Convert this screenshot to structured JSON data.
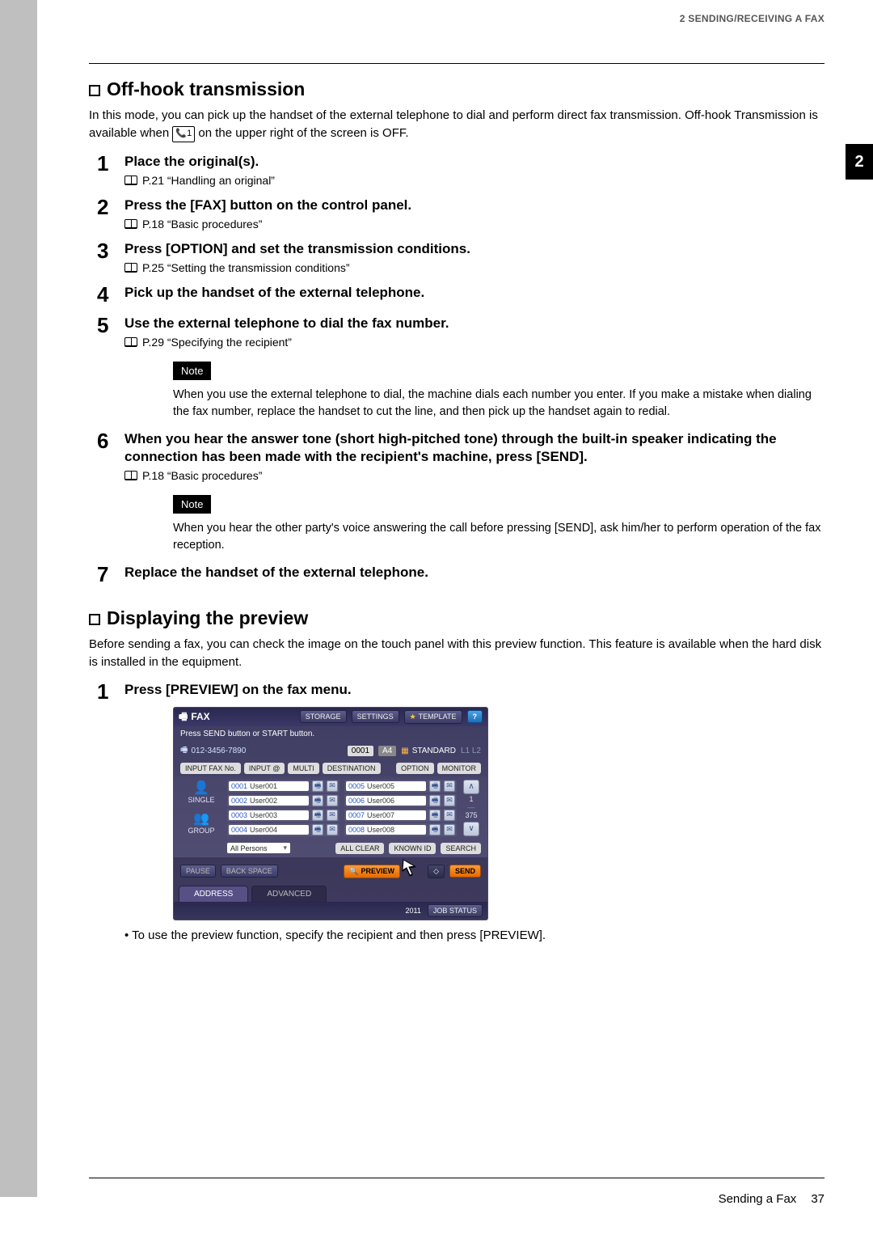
{
  "header": {
    "breadcrumb": "2 SENDING/RECEIVING A FAX"
  },
  "side_tab": "2",
  "section1": {
    "title": "Off-hook transmission",
    "intro_a": "In this mode, you can pick up the handset of the external telephone to dial and perform direct fax transmission. Off-hook Transmission is available when ",
    "intro_icon": "📞1",
    "intro_b": " on the upper right of the screen is OFF."
  },
  "steps": [
    {
      "n": "1",
      "title": "Place the original(s).",
      "ref": "P.21 “Handling an original”"
    },
    {
      "n": "2",
      "title": "Press the [FAX] button on the control panel.",
      "ref": "P.18 “Basic procedures”"
    },
    {
      "n": "3",
      "title": "Press [OPTION] and set the transmission conditions.",
      "ref": "P.25 “Setting the transmission conditions”"
    },
    {
      "n": "4",
      "title": "Pick up the handset of the external telephone."
    },
    {
      "n": "5",
      "title": "Use the external telephone to dial the fax number.",
      "ref": "P.29 “Specifying the recipient”",
      "note": "When you use the external telephone to dial, the machine dials each number you enter. If you make a mistake when dialing the fax number, replace the handset to cut the line, and then pick up the handset again to redial."
    },
    {
      "n": "6",
      "title": "When you hear the answer tone (short high-pitched tone) through the built-in speaker indicating the connection has been made with the recipient's machine, press [SEND].",
      "ref": "P.18 “Basic procedures”",
      "note": "When you hear the other party's voice answering the call before pressing [SEND], ask him/her to perform operation of the fax reception."
    },
    {
      "n": "7",
      "title": "Replace the handset of the external telephone."
    }
  ],
  "note_label": "Note",
  "section2": {
    "title": "Displaying the preview",
    "intro": "Before sending a fax, you can check the image on the touch panel with this preview function. This feature is available when the hard disk is installed in the equipment.",
    "step1": {
      "n": "1",
      "title": "Press [PREVIEW] on the fax menu."
    },
    "bullet": "To use the preview function, specify the recipient and then press [PREVIEW]."
  },
  "fax": {
    "title": "FAX",
    "top_buttons": {
      "storage": "STORAGE",
      "settings": "SETTINGS",
      "template": "TEMPLATE",
      "help": "?"
    },
    "sub_msg": "Press SEND button or START button.",
    "phone": "012-3456-7890",
    "counter": "0001",
    "paper": "A4",
    "standard": "STANDARD",
    "line": "L1 L2",
    "tabs": {
      "input_fax_no": "INPUT FAX No.",
      "input_at": "INPUT @",
      "multi": "MULTI",
      "destination": "DESTINATION",
      "option": "OPTION",
      "monitor": "MONITOR"
    },
    "modes": {
      "single": "SINGLE",
      "group": "GROUP"
    },
    "entries_left": [
      {
        "id": "0001",
        "name": "User001"
      },
      {
        "id": "0002",
        "name": "User002"
      },
      {
        "id": "0003",
        "name": "User003"
      },
      {
        "id": "0004",
        "name": "User004"
      }
    ],
    "entries_right": [
      {
        "id": "0005",
        "name": "User005"
      },
      {
        "id": "0006",
        "name": "User006"
      },
      {
        "id": "0007",
        "name": "User007"
      },
      {
        "id": "0008",
        "name": "User008"
      }
    ],
    "page": {
      "current": "1",
      "total": "375"
    },
    "filter": {
      "dropdown": "All Persons",
      "all_clear": "ALL CLEAR",
      "known_id": "KNOWN ID",
      "search": "SEARCH"
    },
    "actions": {
      "pause": "PAUSE",
      "backspace": "BACK SPACE",
      "preview": "PREVIEW",
      "diamond": "◇",
      "send": "SEND"
    },
    "bottom_tabs": {
      "address": "ADDRESS",
      "advanced": "ADVANCED"
    },
    "status": {
      "date": "2011",
      "job_status": "JOB STATUS"
    }
  },
  "footer": {
    "text": "Sending a Fax",
    "page": "37"
  }
}
